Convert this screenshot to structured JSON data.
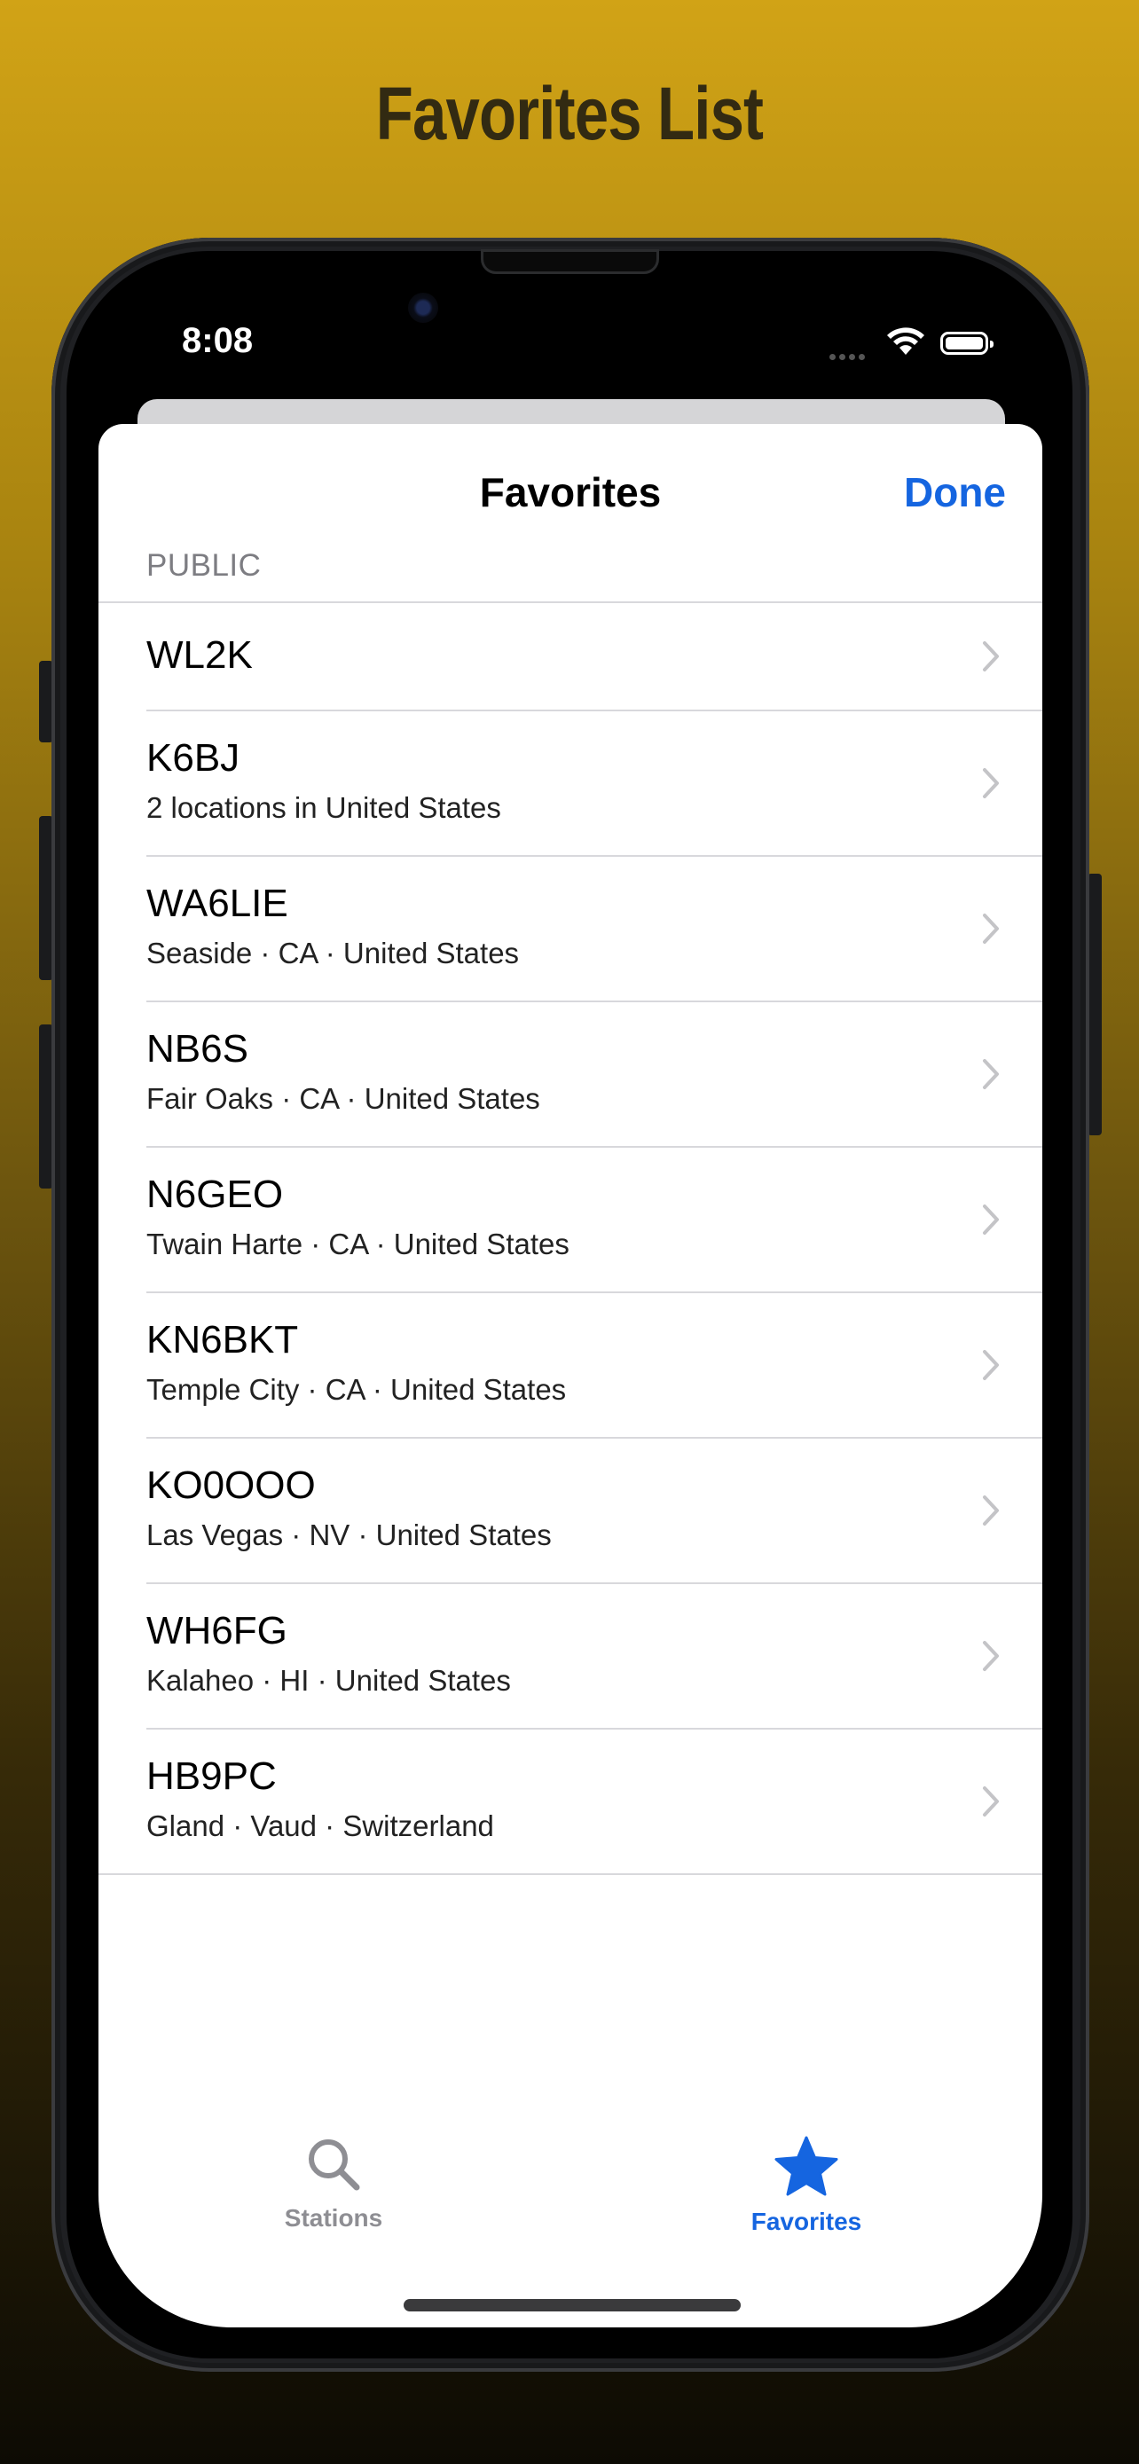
{
  "headline": "Favorites List",
  "status": {
    "time": "8:08"
  },
  "nav": {
    "title": "Favorites",
    "done_label": "Done"
  },
  "section": {
    "header": "PUBLIC"
  },
  "favorites": [
    {
      "callsign": "WL2K",
      "location": ""
    },
    {
      "callsign": "K6BJ",
      "location": "2 locations in United States"
    },
    {
      "callsign": "WA6LIE",
      "location": "Seaside · CA · United States"
    },
    {
      "callsign": "NB6S",
      "location": "Fair Oaks · CA · United States"
    },
    {
      "callsign": "N6GEO",
      "location": "Twain Harte · CA · United States"
    },
    {
      "callsign": "KN6BKT",
      "location": "Temple City · CA · United States"
    },
    {
      "callsign": "KO0OOO",
      "location": "Las Vegas · NV · United States"
    },
    {
      "callsign": "WH6FG",
      "location": "Kalaheo · HI · United States"
    },
    {
      "callsign": "HB9PC",
      "location": "Gland · Vaud · Switzerland"
    }
  ],
  "tabs": {
    "stations": {
      "label": "Stations",
      "icon": "magnifying-glass-icon"
    },
    "favorites": {
      "label": "Favorites",
      "icon": "star-icon",
      "selected": true
    }
  },
  "colors": {
    "accent": "#1565e0",
    "background_top": "#d1a316",
    "background_bottom": "#0d0b04"
  }
}
